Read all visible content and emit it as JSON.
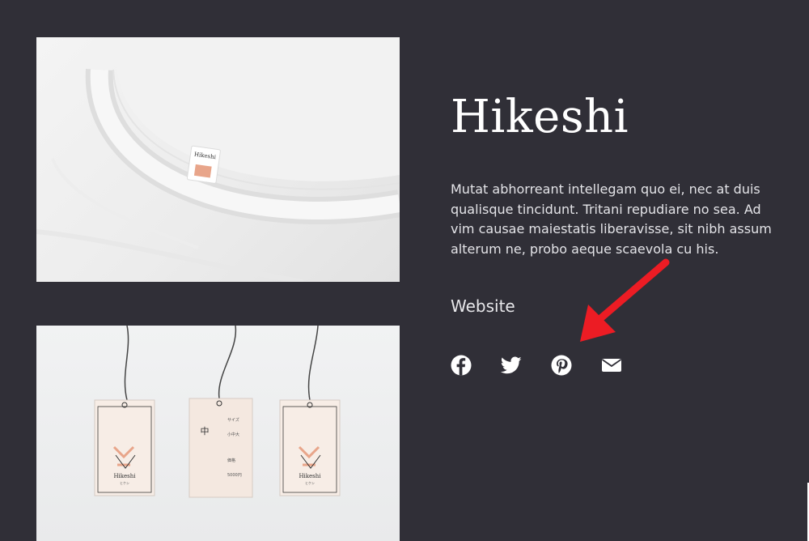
{
  "project": {
    "title": "Hikeshi",
    "description": "Mutat abhorreant intellegam quo ei, nec at duis qualisque tincidunt. Tritani repudiare no sea. Ad vim causae maiestatis liberavisse, sit nibh assum alterum ne, probo aeque scaevola cu his.",
    "website_label": "Website"
  },
  "images": {
    "tshirt_label_brand": "Hikeshi",
    "tags": [
      {
        "brand": "Hikeshi",
        "sub": "ヒケシ"
      },
      {
        "kanji": "中",
        "size_label": "サイズ",
        "size_value": "小中大",
        "price_label": "価格",
        "price_value": "5000円"
      },
      {
        "brand": "Hikeshi",
        "sub": "ヒケシ"
      }
    ]
  },
  "social": [
    {
      "icon": "facebook-icon"
    },
    {
      "icon": "twitter-icon"
    },
    {
      "icon": "pinterest-icon"
    },
    {
      "icon": "envelope-icon"
    }
  ],
  "colors": {
    "background": "#302f37",
    "text": "#ffffff",
    "arrow": "#ec1c24",
    "tag_accent": "#e8a58a"
  }
}
